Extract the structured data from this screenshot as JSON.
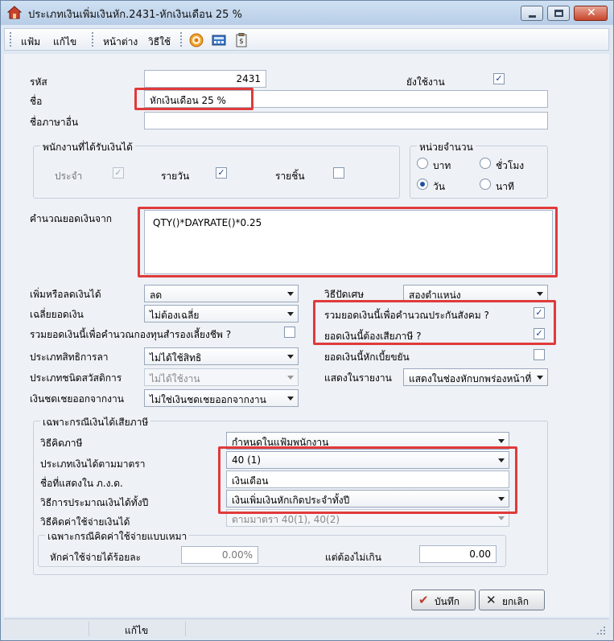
{
  "window": {
    "title": "ประเภทเงินเพิ่มเงินหัก.2431-หักเงินเดือน 25 %"
  },
  "menu": {
    "file": "แฟ้ม",
    "edit": "แก้ไข",
    "window": "หน้าต่าง",
    "help": "วิธีใช้"
  },
  "toolbar": {
    "icons": [
      "target-icon",
      "calculator-icon",
      "clipboard-icon"
    ]
  },
  "form": {
    "code_label": "รหัส",
    "code_value": "2431",
    "name_label": "ชื่อ",
    "name_value": "หักเงินเดือน 25 %",
    "alt_name_label": "ชื่อภาษาอื่น",
    "alt_name_value": "",
    "active_label": "ยังใช้งาน",
    "active_checked": true,
    "employee_group": {
      "title": "พนักงานที่ได้รับเงินได้",
      "monthly_label": "ประจำ",
      "monthly_checked": true,
      "daily_label": "รายวัน",
      "daily_checked": true,
      "piece_label": "รายชิ้น",
      "piece_checked": false
    },
    "unit_group": {
      "title": "หน่วยจำนวน",
      "baht": "บาท",
      "hour": "ชั่วโมง",
      "day": "วัน",
      "minute": "นาที",
      "selected": "day"
    },
    "calc_label": "คำนวณยอดเงินจาก",
    "calc_formula": "QTY()*DAYRATE()*0.25",
    "addsub_label": "เพิ่มหรือลดเงินได้",
    "addsub_value": "ลด",
    "avg_label": "เฉลี่ยยอดเงิน",
    "avg_value": "ไม่ต้องเฉลี่ย",
    "provident_label": "รวมยอดเงินนี้เพื่อคำนวณกองทุนสำรองเลี้ยงชีพ ?",
    "provident_checked": false,
    "leave_label": "ประเภทสิทธิการลา",
    "leave_value": "ไม่ได้ใช้สิทธิ",
    "welfare_label": "ประเภทชนิดสวัสดิการ",
    "welfare_value": "ไม่ได้ใช้งาน",
    "severance_label": "เงินชดเชยออกจากงาน",
    "severance_value": "ไม่ใช่เงินชดเชยออกจากงาน",
    "rounding_label": "วิธีปัดเศษ",
    "rounding_value": "สองตำแหน่ง",
    "social_label": "รวมยอดเงินนี้เพื่อคำนวณประกันสังคม ?",
    "social_checked": true,
    "taxable_label": "ยอดเงินนี้ต้องเสียภาษี ?",
    "taxable_checked": true,
    "allowance_label": "ยอดเงินนี้หักเบี้ยขยัน",
    "allowance_checked": false,
    "display_label": "แสดงในรายงาน",
    "display_value": "แสดงในช่องหักบกพร่องหน้าที่"
  },
  "tax_group": {
    "title": "เฉพาะกรณีเงินได้เสียภาษี",
    "method_label": "วิธีคิดภาษี",
    "method_value": "กำหนดในแฟ้มพนักงาน",
    "section_label": "ประเภทเงินได้ตามมาตรา",
    "section_value": "40 (1)",
    "pnd_label": "ชื่อที่แสดงใน ภ.ง.ด.",
    "pnd_value": "เงินเดือน",
    "estimate_label": "วิธีการประมาณเงินได้ทั้งปี",
    "estimate_value": "เงินเพิ่มเงินหักเกิดประจำทั้งปี",
    "expense_label": "วิธีคิดค่าใช้จ่ายเงินได้",
    "expense_value": "ตามมาตรา 40(1), 40(2)",
    "flat_group": {
      "title": "เฉพาะกรณีคิดค่าใช้จ่ายแบบเหมา",
      "percent_label": "หักค่าใช้จ่ายได้ร้อยละ",
      "percent_value": "0.00%",
      "max_label": "แต่ต้องไม่เกิน",
      "max_value": "0.00"
    }
  },
  "buttons": {
    "save": "บันทึก",
    "cancel": "ยกเลิก"
  },
  "status": {
    "mode": "แก้ไข"
  },
  "colors": {
    "highlight": "#e03a3a",
    "check": "#1c3f8f"
  }
}
